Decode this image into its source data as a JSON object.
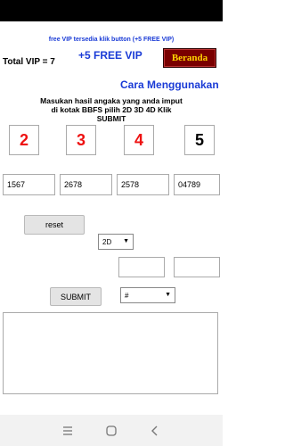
{
  "header": {
    "vip_note": "free VIP tersedia klik button (+5 FREE VIP)",
    "total_vip": "Total VIP = 7",
    "free_vip_label": "+5 FREE VIP",
    "beranda_label": "Beranda"
  },
  "cara_label": "Cara Menggunakan",
  "instruction": "Masukan hasil angaka yang anda imput di kotak BBFS pilih 2D 3D 4D Klik SUBMIT",
  "digits": [
    "2",
    "3",
    "4",
    "5"
  ],
  "inputs": [
    "1567",
    "2678",
    "2578",
    "04789"
  ],
  "reset_label": "reset",
  "mode_select": {
    "selected": "2D"
  },
  "submit_label": "SUBMIT",
  "hash_select": {
    "selected": "#"
  },
  "colors": {
    "blue_text": "#1a3bd6",
    "red_digit": "#ee1111",
    "beranda_bg": "#7a0000",
    "beranda_text": "#ffd400"
  },
  "icons": [
    "recent-apps-icon",
    "home-icon",
    "back-icon"
  ]
}
